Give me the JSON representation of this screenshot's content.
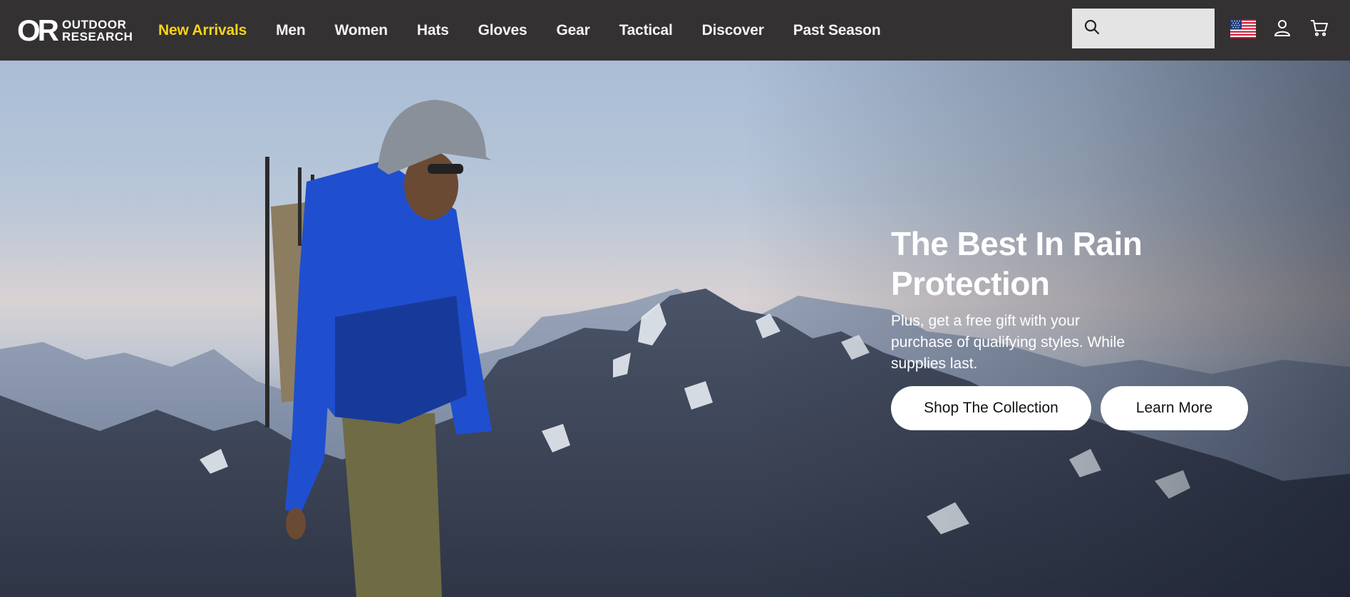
{
  "brand": {
    "mark": "OR",
    "line1": "OUTDOOR",
    "line2": "RESEARCH"
  },
  "nav": [
    {
      "label": "New Arrivals",
      "highlight": true
    },
    {
      "label": "Men"
    },
    {
      "label": "Women"
    },
    {
      "label": "Hats"
    },
    {
      "label": "Gloves"
    },
    {
      "label": "Gear"
    },
    {
      "label": "Tactical"
    },
    {
      "label": "Discover"
    },
    {
      "label": "Past Season"
    }
  ],
  "search": {
    "placeholder": ""
  },
  "icons": {
    "search": "search-icon",
    "flag": "us-flag-icon",
    "account": "user-icon",
    "cart": "cart-icon"
  },
  "hero": {
    "title_line1": "The Best In Rain",
    "title_line2": "Protection",
    "subtitle": "Plus, get a free gift with your purchase of qualifying styles. While supplies last.",
    "primary_button": "Shop The Collection",
    "secondary_button": "Learn More"
  },
  "colors": {
    "header_bg": "#333132",
    "nav_highlight": "#f7d21a",
    "jacket": "#1f4fcf",
    "button_bg": "#ffffff"
  }
}
